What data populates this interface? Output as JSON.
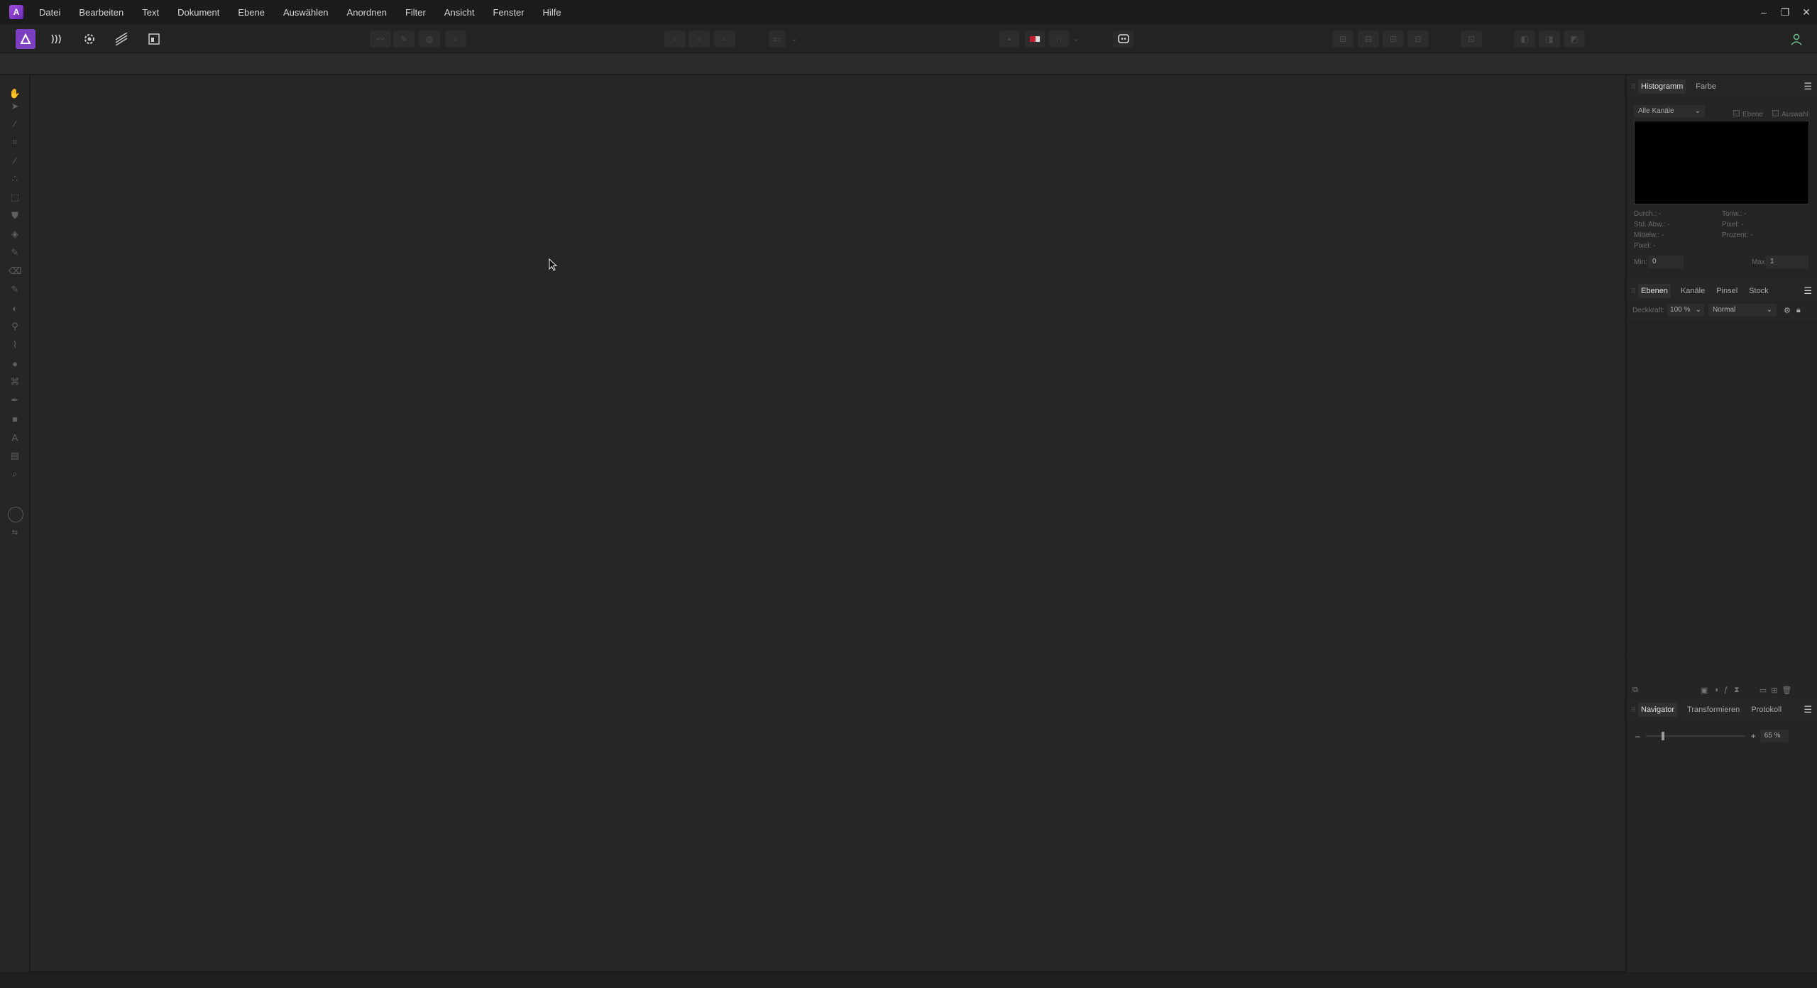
{
  "app": {
    "logo_letter": "A",
    "menu": [
      "Datei",
      "Bearbeiten",
      "Text",
      "Dokument",
      "Ebene",
      "Auswählen",
      "Anordnen",
      "Filter",
      "Ansicht",
      "Fenster",
      "Hilfe"
    ],
    "window_controls": {
      "minimize": "–",
      "restore": "❐",
      "close": "✕"
    }
  },
  "colors": {
    "accent": "#7b3fbf",
    "background": "#262626"
  },
  "toolbar": {
    "personas": [
      "photo-persona",
      "liquify-persona",
      "develop-persona",
      "tone-mapping-persona",
      "export-persona"
    ]
  },
  "panels": {
    "histogram": {
      "tabs": [
        "Histogramm",
        "Farbe"
      ],
      "channel": "Alle Kanäle",
      "check_layer": "Ebene",
      "check_selection": "Auswahl",
      "stats_left": [
        "Durch.: -",
        "Std. Abw.: -",
        "Mittelw.: -",
        "Pixel: -"
      ],
      "stats_right": [
        "Tonw.: -",
        "Pixel: -",
        "Prozent: -"
      ],
      "min_label": "Min:",
      "min_value": "0",
      "max_label": "Max:",
      "max_value": "1"
    },
    "layers": {
      "tabs": [
        "Ebenen",
        "Kanäle",
        "Pinsel",
        "Stock"
      ],
      "opacity_label": "Deckkraft:",
      "opacity_value": "100 %",
      "blend_mode": "Normal"
    },
    "navigator": {
      "tabs": [
        "Navigator",
        "Transformieren",
        "Protokoll"
      ],
      "zoom_value": "65 %",
      "zoom_minus": "–",
      "zoom_plus": "+"
    }
  }
}
